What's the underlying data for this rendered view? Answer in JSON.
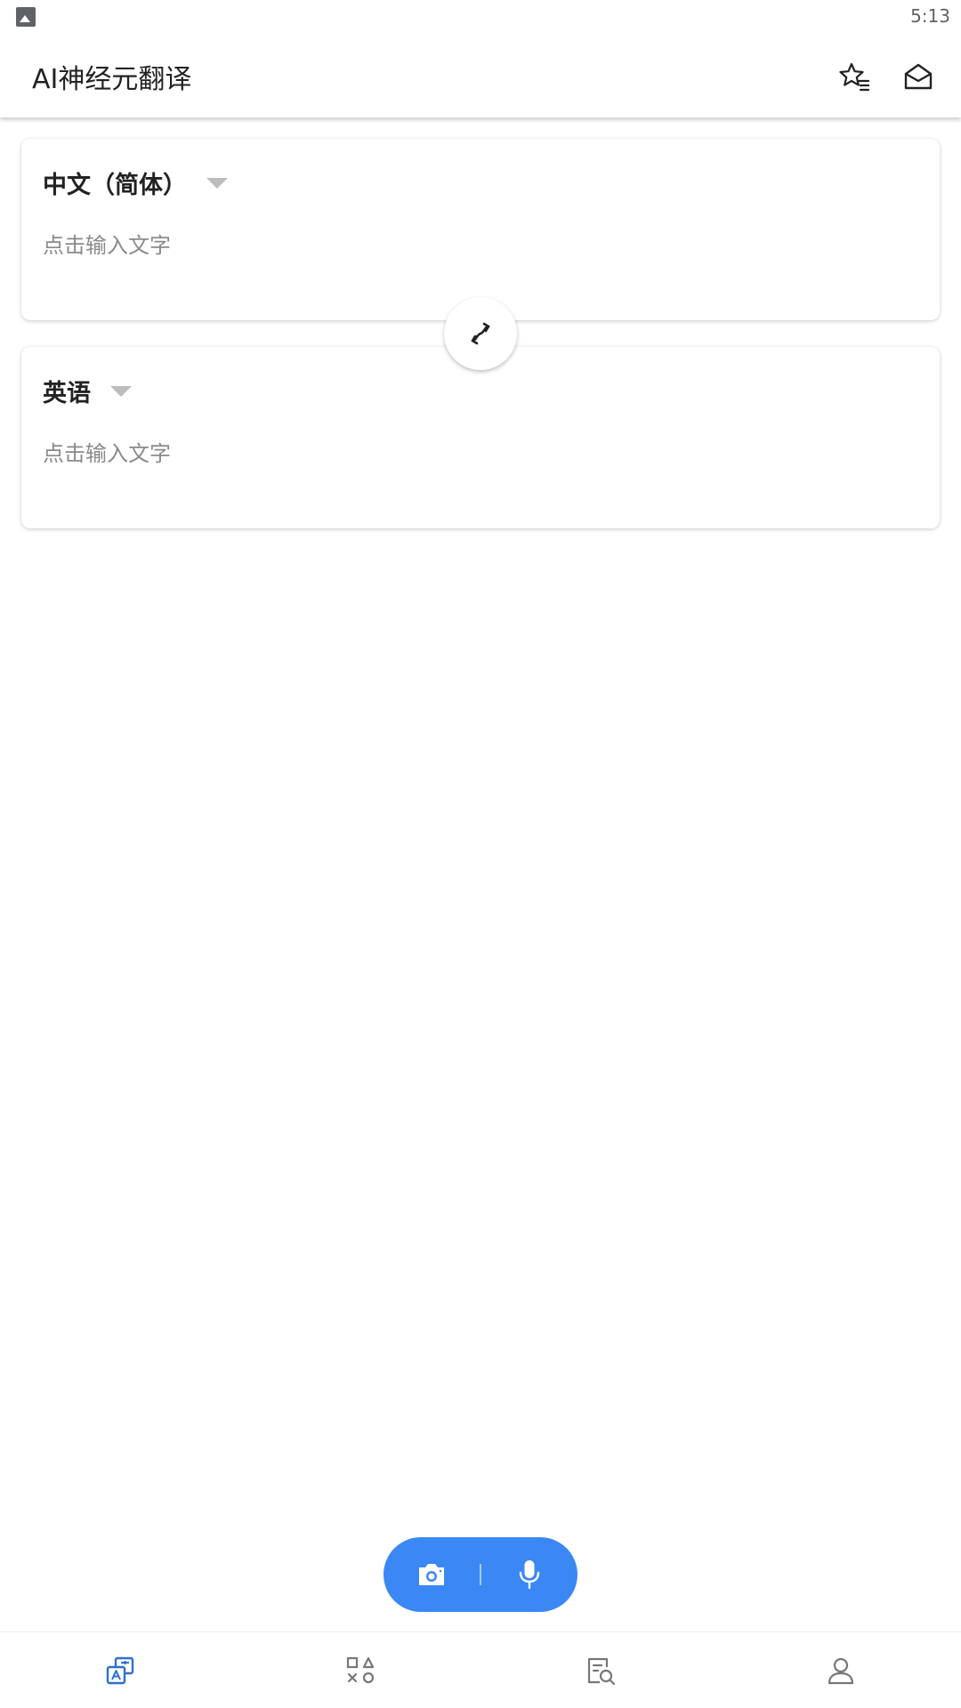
{
  "status_bar": {
    "time": "5:13",
    "notification_icon": "gallery-icon"
  },
  "app_bar": {
    "title": "AI神经元翻译",
    "actions": [
      {
        "icon": "favorites-list-icon"
      },
      {
        "icon": "inbox-icon"
      }
    ]
  },
  "source_card": {
    "language": "中文（简体）",
    "placeholder": "点击输入文字"
  },
  "target_card": {
    "language": "英语",
    "placeholder": "点击输入文字"
  },
  "swap": {
    "icon": "swap-arrows-icon"
  },
  "action_pill": {
    "color": "#3b88f4",
    "buttons": [
      {
        "icon": "camera-icon"
      },
      {
        "icon": "microphone-icon"
      }
    ]
  },
  "bottom_nav": {
    "active_color": "#2f6fd0",
    "items": [
      {
        "icon": "translate-icon",
        "active": true
      },
      {
        "icon": "apps-grid-icon",
        "active": false
      },
      {
        "icon": "document-search-icon",
        "active": false
      },
      {
        "icon": "profile-icon",
        "active": false
      }
    ]
  }
}
